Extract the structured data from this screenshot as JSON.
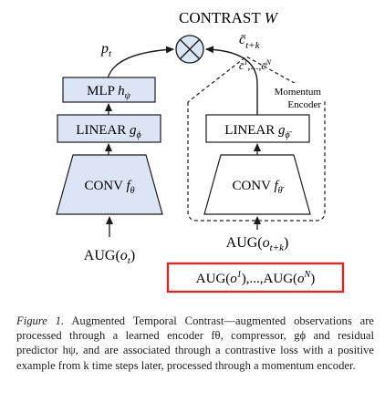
{
  "diagram": {
    "title": {
      "text": "CONTRAST",
      "var": "W"
    },
    "left_arrow_label": {
      "main": "p",
      "sub": "t"
    },
    "right_arrow_label": {
      "main": "c̄",
      "sub": "t+k"
    },
    "negatives_label": {
      "first": "c̄",
      "first_sup": "1",
      "sep": ",...,",
      "last": "c̄",
      "last_sup": "N"
    },
    "momentum_label": {
      "line1": "Momentum",
      "line2": "Encoder"
    },
    "mlp": {
      "name": "MLP",
      "var": "h",
      "sub": "ψ"
    },
    "linear_left": {
      "name": "LINEAR",
      "var": "g",
      "sub": "ϕ"
    },
    "linear_right": {
      "name": "LINEAR",
      "var": "g",
      "sub": "ϕ̄"
    },
    "conv_left": {
      "name": "CONV",
      "var": "f",
      "sub": "θ"
    },
    "conv_right": {
      "name": "CONV",
      "var": "f",
      "sub": "θ̄"
    },
    "aug_left": {
      "prefix": "AUG(",
      "var": "o",
      "sub": "t",
      "suffix": ")"
    },
    "aug_right": {
      "prefix": "AUG(",
      "var": "o",
      "sub": "t+k",
      "suffix": ")"
    },
    "aug_negatives": {
      "a": "AUG(",
      "o1": "o",
      "sup1": "1",
      "mid": "),...,AUG(",
      "oN": "o",
      "supN": "N",
      "end": ")"
    }
  },
  "caption": {
    "label": "Figure 1.",
    "text": "Augmented Temporal Contrast—augmented observations are processed through a learned encoder fθ, compressor, gϕ and residual predictor hψ, and are associated through a contrastive loss with a positive example from k time steps later, processed through a momentum encoder."
  },
  "colors": {
    "box_fill": "#dbe5f5",
    "box_stroke": "#1a1a1a",
    "highlight_red": "#d72a2a"
  }
}
